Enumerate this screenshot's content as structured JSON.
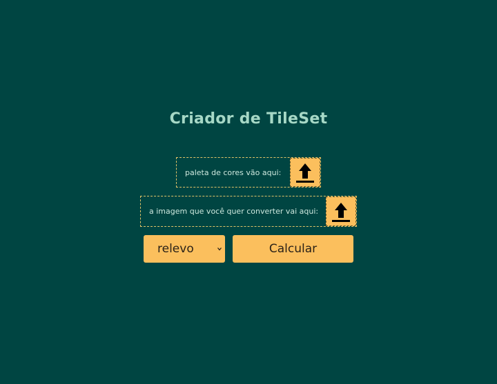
{
  "page": {
    "title": "Criador de TileSet",
    "background_color": "#004542",
    "accent_color": "#fbbf5d"
  },
  "palette_upload": {
    "label": "paleta de cores vão aqui:",
    "icon": "upload-arrow-icon"
  },
  "image_upload": {
    "label": "a imagem que você quer converter vai aqui:",
    "icon": "upload-arrow-icon"
  },
  "mode_select": {
    "selected": "relevo",
    "icon": "chevron-down-icon"
  },
  "calculate_button": {
    "label": "Calcular"
  }
}
